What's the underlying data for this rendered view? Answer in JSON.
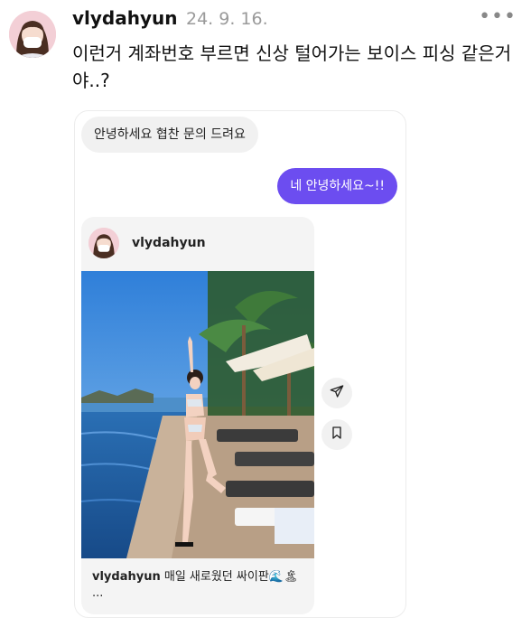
{
  "post": {
    "username": "vlydahyun",
    "date": "24. 9. 16.",
    "more_glyph": "•••",
    "text": "이런거 계좌번호 부르면 신상 털어가는 보이스 피싱 같은거야..?"
  },
  "chat": {
    "incoming_message": "안녕하세요 협찬 문의 드려요",
    "outgoing_message": "네 안녕하세요~!!"
  },
  "shared_post": {
    "username": "vlydahyun",
    "caption_username": "vlydahyun",
    "caption_text": "매일 새로웠던 싸이판🌊🏝 ..."
  },
  "icons": {
    "share": "paper-plane-icon",
    "save": "bookmark-icon"
  },
  "colors": {
    "accent": "#6c4df0",
    "bubble_gray": "#f1f1f1",
    "date_gray": "#9a9a9a"
  }
}
